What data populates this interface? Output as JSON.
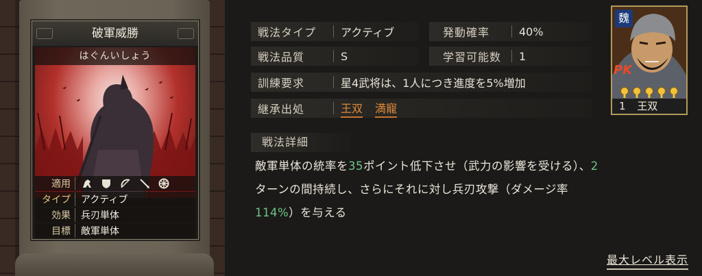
{
  "card": {
    "title": "破軍威勝",
    "reading": "はぐんいしょう",
    "stats": [
      {
        "label": "適用",
        "value": ""
      },
      {
        "label": "タイプ",
        "value": "アクティブ"
      },
      {
        "label": "効果",
        "value": "兵刃単体"
      },
      {
        "label": "目標",
        "value": "敵軍単体"
      }
    ],
    "applicable_icons": [
      "cavalry-icon",
      "shield-icon",
      "bow-icon",
      "spear-icon",
      "wheel-icon"
    ]
  },
  "info": {
    "type_label": "戦法タイプ",
    "type_value": "アクティブ",
    "rate_label": "発動確率",
    "rate_value": "40%",
    "quality_label": "戦法品質",
    "quality_value": "S",
    "learn_label": "学習可能数",
    "learn_value": "1",
    "train_label": "訓練要求",
    "train_value": "星4武将は、1人につき進度を5%増加",
    "inherit_label": "継承出処",
    "inherit_sources": [
      "王双",
      "満寵"
    ]
  },
  "detail": {
    "header": "戦法詳細",
    "seg1": "敵軍単体の統率を",
    "num1": "35",
    "seg2": "ポイント低下させ（武力の影響を受ける）、",
    "num2": "2",
    "seg3": "ターンの間持続し、さらにそれに対し兵刃攻撃（ダメージ率",
    "num3": "114%",
    "seg4": "）を与える"
  },
  "max_level_link": "最大レベル表示",
  "portrait": {
    "kingdom": "魏",
    "badge": "PK",
    "star_count": 5,
    "level": "1",
    "name": "王双"
  },
  "colors": {
    "accent": "#e08a3a",
    "number": "#6fc489",
    "card_bg": "#b2302b"
  }
}
